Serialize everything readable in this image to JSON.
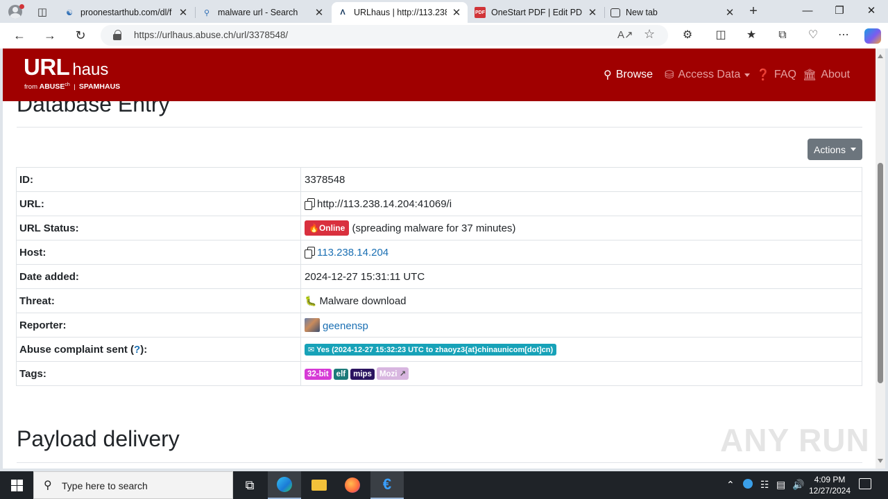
{
  "browser": {
    "tabs": [
      {
        "title": "proonestarthub.com/dl/f",
        "icon": "globe-icon"
      },
      {
        "title": "malware url - Search",
        "icon": "search-icon"
      },
      {
        "title": "URLhaus | http://113.238",
        "icon": "urlhaus-icon",
        "active": true
      },
      {
        "title": "OneStart PDF | Edit PDF",
        "icon": "pdf-icon"
      },
      {
        "title": "New tab",
        "icon": "newtab-icon"
      }
    ],
    "address": "https://urlhaus.abuse.ch/url/3378548/"
  },
  "site": {
    "logo_main": "URL",
    "logo_sub": "haus",
    "logo_from": "from",
    "logo_abuse": "ABUSE",
    "logo_ch": "ch",
    "logo_spamhaus": "SPAMHAUS",
    "nav": {
      "browse": "Browse",
      "access_data": "Access Data",
      "faq": "FAQ",
      "about": "About"
    },
    "brand_color": "#a00000"
  },
  "entry": {
    "title": "Database Entry",
    "actions_label": "Actions",
    "rows": {
      "id": {
        "label": "ID:",
        "value": "3378548"
      },
      "url": {
        "label": "URL:",
        "value": "http://113.238.14.204:41069/i"
      },
      "status": {
        "label": "URL Status:",
        "badge": "Online",
        "note": "(spreading malware for 37 minutes)"
      },
      "host": {
        "label": "Host:",
        "value": "113.238.14.204"
      },
      "date_added": {
        "label": "Date added:",
        "value": "2024-12-27 15:31:11 UTC"
      },
      "threat": {
        "label": "Threat:",
        "value": "Malware download"
      },
      "reporter": {
        "label": "Reporter:",
        "value": "geenensp"
      },
      "abuse": {
        "label_pre": "Abuse complaint sent (",
        "label_q": "?",
        "label_post": "):",
        "value": "Yes (2024-12-27 15:32:23 UTC to zhaoyz3{at}chinaunicom[dot]cn)"
      },
      "tags": {
        "label": "Tags:",
        "items": [
          {
            "text": "32-bit",
            "color": "#d63ad6"
          },
          {
            "text": "elf",
            "color": "#1c7a7a"
          },
          {
            "text": "mips",
            "color": "#2b1460"
          },
          {
            "text": "Mozi",
            "color": "#d8b6e0"
          }
        ]
      }
    }
  },
  "payload": {
    "title": "Payload delivery"
  },
  "watermark": "ANY RUN",
  "taskbar": {
    "search_placeholder": "Type here to search",
    "time": "4:09 PM",
    "date": "12/27/2024"
  }
}
